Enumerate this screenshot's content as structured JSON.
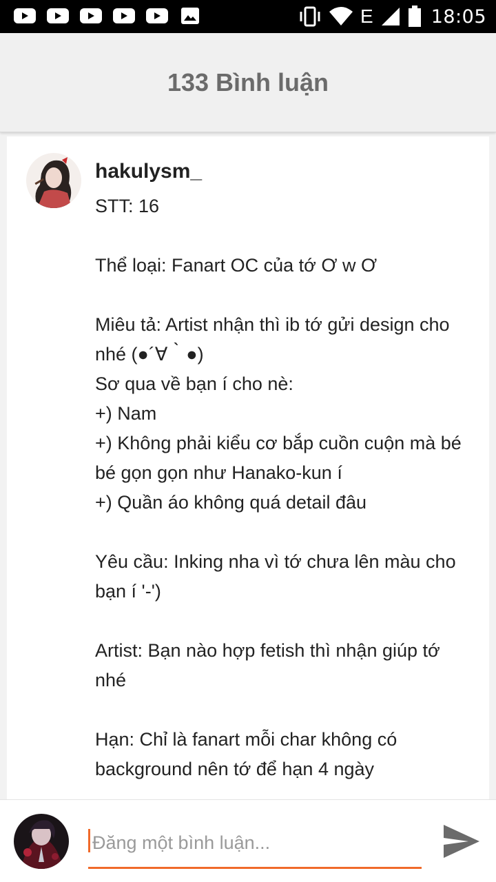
{
  "status_bar": {
    "time": "18:05",
    "network_type": "E",
    "notification_icons": [
      "youtube-icon",
      "youtube-icon",
      "youtube-icon",
      "youtube-icon",
      "youtube-icon",
      "gallery-icon"
    ],
    "system_icons": [
      "vibrate-icon",
      "wifi-icon",
      "signal-icon",
      "battery-icon"
    ]
  },
  "header": {
    "title": "133 Bình luận"
  },
  "comment": {
    "username": "hakulysm_",
    "lines": [
      "STT: 16",
      "",
      "Thể loại: Fanart OC của tớ Ơ w Ơ",
      "",
      "Miêu tả: Artist nhận thì ib tớ gửi design cho",
      "nhé (●´∀｀●)",
      "Sơ qua về bạn í cho nè:",
      "+) Nam",
      "+) Không phải kiểu cơ bắp cuồn cuộn mà bé",
      "bé gọn gọn như Hanako-kun í",
      "+) Quần áo không quá detail đâu",
      "",
      "Yêu cầu: Inking nha vì tớ chưa lên màu cho",
      "bạn í '-')",
      "",
      "Artist: Bạn nào hợp fetish thì nhận giúp tớ",
      "nhé",
      "",
      "Hạn: Chỉ là fanart mỗi char không có",
      "background nên tớ để hạn 4 ngày"
    ]
  },
  "composer": {
    "placeholder": "Đăng một bình luận...",
    "value": "",
    "send_icon": "send-icon"
  },
  "colors": {
    "accent": "#f06a2a",
    "header_bg": "#f0f0f0",
    "title_text": "#6b6b6b",
    "status_bar_bg": "#000000"
  }
}
